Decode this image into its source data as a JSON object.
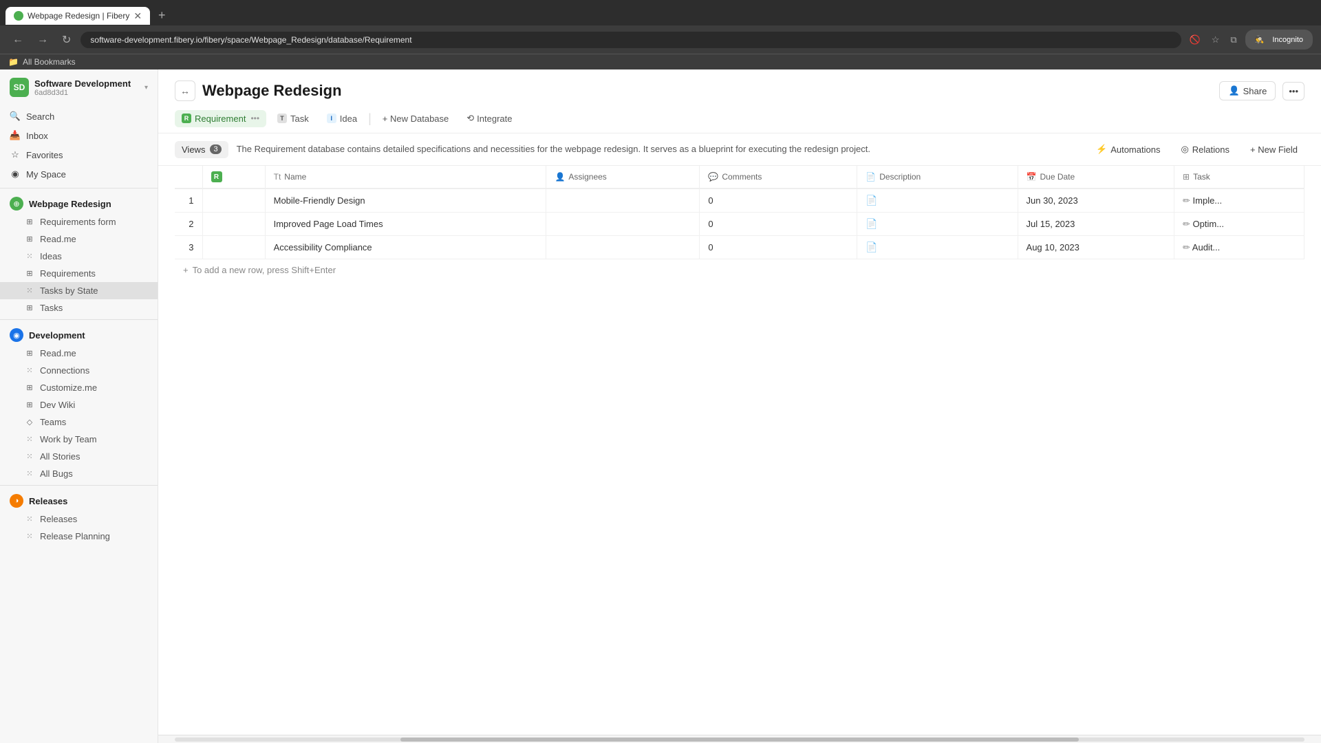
{
  "browser": {
    "tab_title": "Webpage Redesign | Fibery",
    "tab_favicon": "F",
    "address": "software-development.fibery.io/fibery/space/Webpage_Redesign/database/Requirement",
    "incognito_label": "Incognito",
    "bookmarks_label": "All Bookmarks"
  },
  "sidebar": {
    "workspace": {
      "name": "Software Development",
      "id": "6ad8d3d1"
    },
    "search_label": "Search",
    "inbox_label": "Inbox",
    "favorites_label": "Favorites",
    "my_space_label": "My Space",
    "groups": [
      {
        "name": "Webpage Redesign",
        "color": "green",
        "items": [
          {
            "label": "Requirements form",
            "icon": "⊞"
          },
          {
            "label": "Read.me",
            "icon": "⊞"
          },
          {
            "label": "Ideas",
            "icon": "⁙"
          },
          {
            "label": "Requirements",
            "icon": "⊞"
          },
          {
            "label": "Tasks by State",
            "icon": "⁙"
          },
          {
            "label": "Tasks",
            "icon": "⊞"
          }
        ]
      },
      {
        "name": "Development",
        "color": "blue",
        "items": [
          {
            "label": "Read.me",
            "icon": "⊞"
          },
          {
            "label": "Connections",
            "icon": "⁙"
          },
          {
            "label": "Customize.me",
            "icon": "⊞"
          },
          {
            "label": "Dev Wiki",
            "icon": "⊞"
          },
          {
            "label": "Teams",
            "icon": "◇"
          },
          {
            "label": "Work by Team",
            "icon": "⁙"
          },
          {
            "label": "All Stories",
            "icon": "⁙"
          },
          {
            "label": "All Bugs",
            "icon": "⁙"
          }
        ]
      },
      {
        "name": "Releases",
        "color": "orange",
        "items": [
          {
            "label": "Releases",
            "icon": "⁙"
          },
          {
            "label": "Release Planning",
            "icon": "⁙"
          }
        ]
      }
    ]
  },
  "page": {
    "title": "Webpage Redesign",
    "description": "The Requirement database contains detailed specifications and necessities for the webpage redesign. It serves as a blueprint for executing the redesign project.",
    "tabs": [
      {
        "label": "Requirement",
        "key": "requirement",
        "active": true,
        "dot": "R"
      },
      {
        "label": "Task",
        "key": "task",
        "active": false,
        "dot": "T"
      },
      {
        "label": "Idea",
        "key": "idea",
        "active": false,
        "dot": "I"
      }
    ],
    "new_db_label": "+ New Database",
    "integrate_label": "Integrate",
    "share_label": "Share",
    "views_label": "Views",
    "views_count": "3",
    "automations_label": "Automations",
    "relations_label": "Relations",
    "new_field_label": "+ New Field"
  },
  "table": {
    "columns": [
      {
        "label": "",
        "key": "num"
      },
      {
        "label": "",
        "key": "badge"
      },
      {
        "label": "Name",
        "icon": "Tt"
      },
      {
        "label": "Assignees",
        "icon": "👤"
      },
      {
        "label": "Comments",
        "icon": "💬"
      },
      {
        "label": "Description",
        "icon": "📄"
      },
      {
        "label": "Due Date",
        "icon": "📅"
      },
      {
        "label": "Task",
        "icon": "⊞"
      }
    ],
    "rows": [
      {
        "num": 1,
        "name": "Mobile-Friendly Design",
        "assignees": "",
        "comments": "0",
        "description": "📄",
        "due_date": "Jun 30, 2023",
        "task": "Imple..."
      },
      {
        "num": 2,
        "name": "Improved Page Load Times",
        "assignees": "",
        "comments": "0",
        "description": "📄",
        "due_date": "Jul 15, 2023",
        "task": "Optim..."
      },
      {
        "num": 3,
        "name": "Accessibility Compliance",
        "assignees": "",
        "comments": "0",
        "description": "📄",
        "due_date": "Aug 10, 2023",
        "task": "Audit..."
      }
    ],
    "add_row_placeholder": "To add a new row, press Shift+Enter"
  }
}
